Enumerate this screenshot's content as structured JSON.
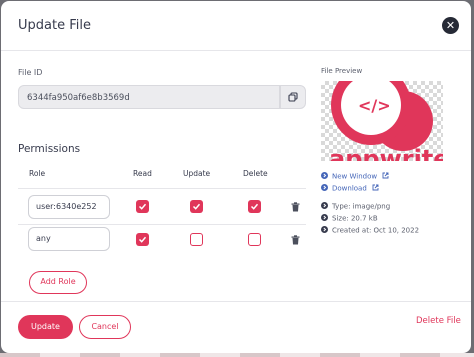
{
  "modal": {
    "title": "Update File"
  },
  "file_id": {
    "label": "File ID",
    "value": "6344fa950af6e8b3569d"
  },
  "permissions": {
    "title": "Permissions",
    "columns": [
      "Role",
      "Read",
      "Update",
      "Delete"
    ],
    "rows": [
      {
        "role": "user:6340e252",
        "read": true,
        "update": true,
        "delete": true
      },
      {
        "role": "any",
        "read": true,
        "update": false,
        "delete": false
      }
    ],
    "add_role_label": "Add Role"
  },
  "preview": {
    "label": "File Preview",
    "new_window": "New Window",
    "download": "Download",
    "type": "Type: image/png",
    "size": "Size: 20.7 kB",
    "created": "Created at: Oct 10, 2022"
  },
  "footer": {
    "update": "Update",
    "cancel": "Cancel",
    "delete": "Delete File"
  },
  "colors": {
    "accent": "#e0365a",
    "link": "#4566b8",
    "dark": "#262a36"
  }
}
